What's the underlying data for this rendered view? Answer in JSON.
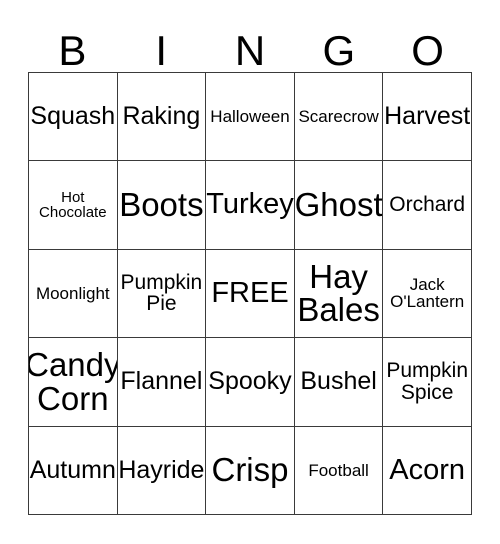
{
  "card": {
    "header_letters": [
      "B",
      "I",
      "N",
      "G",
      "O"
    ],
    "border_color": "#3a3a3a",
    "background_color": "#ffffff",
    "text_color": "#000000",
    "rows": [
      [
        {
          "text": "Squash",
          "size": "fs-lg"
        },
        {
          "text": "Raking",
          "size": "fs-lg"
        },
        {
          "text": "Halloween",
          "size": "fs-sm"
        },
        {
          "text": "Scarecrow",
          "size": "fs-sm"
        },
        {
          "text": "Harvest",
          "size": "fs-lg"
        }
      ],
      [
        {
          "text": "Hot\nChocolate",
          "size": "fs-xs"
        },
        {
          "text": "Boots",
          "size": "fs-xxl"
        },
        {
          "text": "Turkey",
          "size": "fs-xl"
        },
        {
          "text": "Ghost",
          "size": "fs-xxl"
        },
        {
          "text": "Orchard",
          "size": "fs-md"
        }
      ],
      [
        {
          "text": "Moonlight",
          "size": "fs-sm"
        },
        {
          "text": "Pumpkin\nPie",
          "size": "fs-md"
        },
        {
          "text": "FREE",
          "size": "fs-xl"
        },
        {
          "text": "Hay\nBales",
          "size": "fs-xxl"
        },
        {
          "text": "Jack\nO'Lantern",
          "size": "fs-sm"
        }
      ],
      [
        {
          "text": "Candy\nCorn",
          "size": "fs-xxl"
        },
        {
          "text": "Flannel",
          "size": "fs-lg"
        },
        {
          "text": "Spooky",
          "size": "fs-lg"
        },
        {
          "text": "Bushel",
          "size": "fs-lg"
        },
        {
          "text": "Pumpkin\nSpice",
          "size": "fs-md"
        }
      ],
      [
        {
          "text": "Autumn",
          "size": "fs-lg"
        },
        {
          "text": "Hayride",
          "size": "fs-lg"
        },
        {
          "text": "Crisp",
          "size": "fs-xxl"
        },
        {
          "text": "Football",
          "size": "fs-sm"
        },
        {
          "text": "Acorn",
          "size": "fs-xl"
        }
      ]
    ]
  }
}
